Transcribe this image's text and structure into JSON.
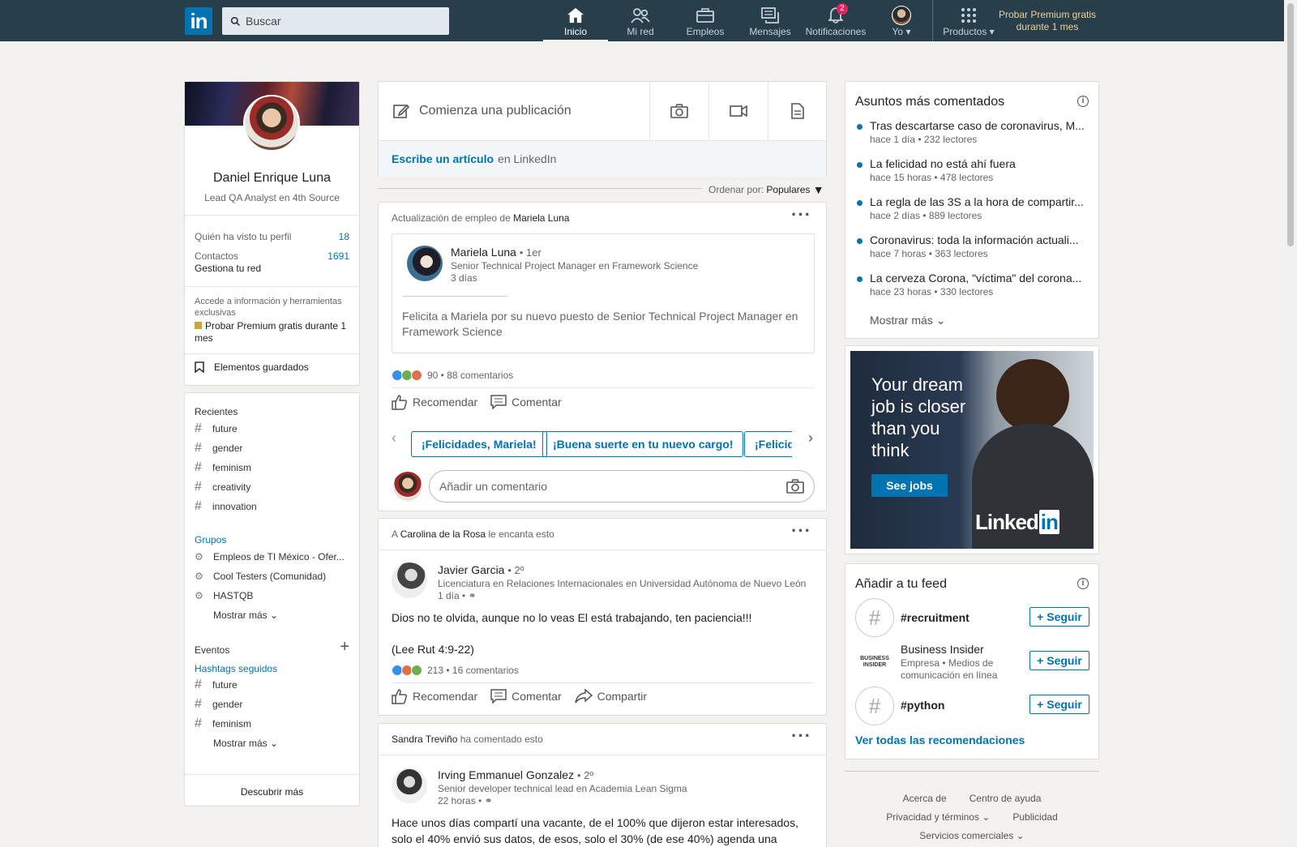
{
  "nav": {
    "search_placeholder": "Buscar",
    "items": [
      {
        "label": "Inicio",
        "icon": "home-icon"
      },
      {
        "label": "Mi red",
        "icon": "network-icon"
      },
      {
        "label": "Empleos",
        "icon": "briefcase-icon"
      },
      {
        "label": "Mensajes",
        "icon": "messages-icon"
      },
      {
        "label": "Notificaciones",
        "icon": "bell-icon",
        "badge": "2"
      },
      {
        "label": "Yo",
        "icon": "avatar"
      },
      {
        "label": "Productos",
        "icon": "grid-icon"
      }
    ],
    "premium": "Probar Premium gratis durante 1 mes"
  },
  "profile": {
    "name": "Daniel Enrique Luna",
    "headline": "Lead QA Analyst en 4th Source",
    "views_label": "Quién ha visto tu perfil",
    "views_count": "18",
    "contacts_label": "Contactos",
    "contacts_count": "1691",
    "manage_network": "Gestiona tu red",
    "premium_text": "Accede a información y herramientas exclusivas",
    "premium_link": "Probar Premium gratis durante 1 mes",
    "saved": "Elementos guardados"
  },
  "sidebar": {
    "recent_title": "Recientes",
    "recent": [
      "future",
      "gender",
      "feminism",
      "creativity",
      "innovation"
    ],
    "groups_title": "Grupos",
    "groups": [
      "Empleos de TI México - Ofer...",
      "Cool Testers (Comunidad)",
      "HASTQB"
    ],
    "show_more": "Mostrar más",
    "events_title": "Eventos",
    "hashtags_title": "Hashtags seguidos",
    "hashtags": [
      "future",
      "gender",
      "feminism"
    ],
    "discover": "Descubrir más"
  },
  "composer": {
    "start_post": "Comienza una publicación",
    "write_article": "Escribe un artículo",
    "on_linkedin": "en LinkedIn"
  },
  "sort": {
    "label": "Ordenar por:",
    "value": "Populares"
  },
  "post1": {
    "header_prefix": "Actualización de empleo de",
    "header_name": "Mariela Luna",
    "author": "Mariela Luna",
    "degree": "• 1er",
    "author_headline": "Senior Technical Project Manager en Framework Science",
    "time": "3 días",
    "text": "Felicita a Mariela por su nuevo puesto de Senior Technical Project Manager en Framework Science",
    "reactions": "90 • 88 comentarios",
    "recommend": "Recomendar",
    "comment": "Comentar",
    "suggestions": [
      "¡Felicidades, Mariela!",
      "¡Buena suerte en tu nuevo cargo!",
      "¡Felicida"
    ],
    "comment_placeholder": "Añadir un comentario"
  },
  "post2": {
    "header_prefix": "A",
    "header_name": "Carolina de la Rosa",
    "header_suffix": "le encanta esto",
    "author": "Javier Garcia",
    "degree": "• 2º",
    "author_headline": "Licenciatura en Relaciones Internacionales en Universidad Autónoma de Nuevo León",
    "time": "1 día •",
    "text1": "Dios no te olvida, aunque no lo veas El está trabajando, ten paciencia!!!",
    "text2": "(Lee Rut 4:9-22)",
    "reactions": "213 • 16 comentarios",
    "recommend": "Recomendar",
    "comment": "Comentar",
    "share": "Compartir"
  },
  "post3": {
    "header_name": "Sandra Treviño",
    "header_suffix": "ha comentado esto",
    "author": "Irving Emmanuel Gonzalez",
    "degree": "• 2º",
    "author_headline": "Senior developer technical lead en Academia Lean Sigma",
    "time": "22 horas •",
    "text": "Hace unos días compartí una vacante, de el 100% que dijeron estar interesados, solo el 40% envió sus datos, de esos, solo el 30% (de ese 40%) agenda una llamada,"
  },
  "news": {
    "title": "Asuntos más comentados",
    "items": [
      {
        "title": "Tras descartarse caso de coronavirus, M...",
        "sub": "hace 1 día • 232 lectores"
      },
      {
        "title": "La felicidad no está ahí fuera",
        "sub": "hace 15 horas • 478 lectores"
      },
      {
        "title": "La regla de las 3S a la hora de compartir...",
        "sub": "hace 2 días • 889 lectores"
      },
      {
        "title": "Coronavirus: toda la información actuali...",
        "sub": "hace 7 horas • 363 lectores"
      },
      {
        "title": "La cerveza Corona, \"víctima\" del corona...",
        "sub": "hace 23 horas • 330 lectores"
      }
    ],
    "show_more": "Mostrar más"
  },
  "ad": {
    "line1": "Your dream",
    "line2": "job is closer",
    "line3": "than you",
    "line4": "think",
    "button": "See jobs",
    "brand": "Linked"
  },
  "feed_suggest": {
    "title": "Añadir a tu feed",
    "items": [
      {
        "name": "#recruitment",
        "sub": ""
      },
      {
        "name": "Business Insider",
        "sub": "Empresa • Medios de comunicación en línea"
      },
      {
        "name": "#python",
        "sub": ""
      }
    ],
    "follow": "Seguir",
    "see_all": "Ver todas las recomendaciones"
  },
  "footer": {
    "about": "Acerca de",
    "help": "Centro de ayuda",
    "privacy": "Privacidad y términos",
    "ads": "Publicidad",
    "business": "Servicios comerciales"
  },
  "colors": {
    "brand": "#0073b1",
    "nav_bg": "#283e4a",
    "badge": "#e0245e"
  }
}
